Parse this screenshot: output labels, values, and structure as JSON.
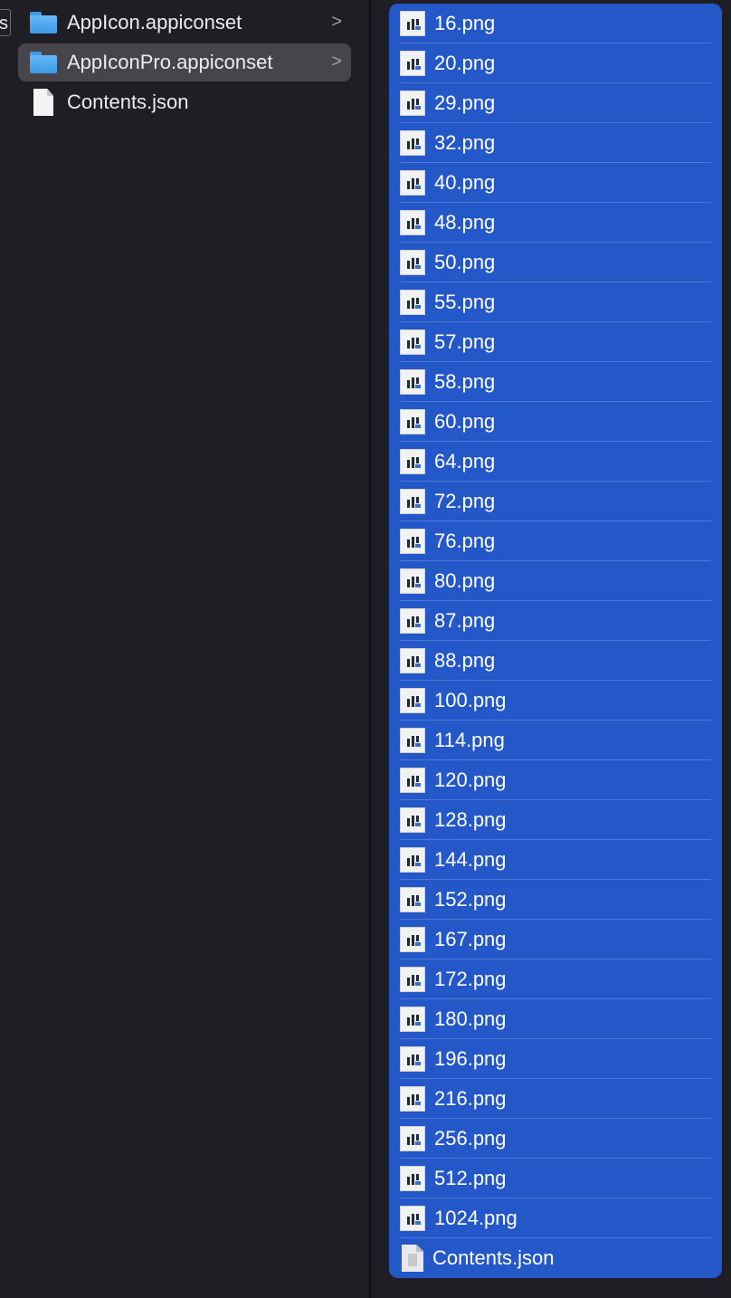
{
  "left_column": {
    "prev_column_edge": "s",
    "items": [
      {
        "label": "AppIcon.appiconset",
        "icon": "folder-icon",
        "has_chevron": true,
        "selected": false
      },
      {
        "label": "AppIconPro.appiconset",
        "icon": "folder-icon",
        "has_chevron": true,
        "selected": true
      },
      {
        "label": "Contents.json",
        "icon": "document-icon",
        "has_chevron": false,
        "selected": false
      }
    ],
    "chevron": ">"
  },
  "right_column": {
    "files": [
      {
        "label": "16.png",
        "icon": "png-image-icon"
      },
      {
        "label": "20.png",
        "icon": "png-image-icon"
      },
      {
        "label": "29.png",
        "icon": "png-image-icon"
      },
      {
        "label": "32.png",
        "icon": "png-image-icon"
      },
      {
        "label": "40.png",
        "icon": "png-image-icon"
      },
      {
        "label": "48.png",
        "icon": "png-image-icon"
      },
      {
        "label": "50.png",
        "icon": "png-image-icon"
      },
      {
        "label": "55.png",
        "icon": "png-image-icon"
      },
      {
        "label": "57.png",
        "icon": "png-image-icon"
      },
      {
        "label": "58.png",
        "icon": "png-image-icon"
      },
      {
        "label": "60.png",
        "icon": "png-image-icon"
      },
      {
        "label": "64.png",
        "icon": "png-image-icon"
      },
      {
        "label": "72.png",
        "icon": "png-image-icon"
      },
      {
        "label": "76.png",
        "icon": "png-image-icon"
      },
      {
        "label": "80.png",
        "icon": "png-image-icon"
      },
      {
        "label": "87.png",
        "icon": "png-image-icon"
      },
      {
        "label": "88.png",
        "icon": "png-image-icon"
      },
      {
        "label": "100.png",
        "icon": "png-image-icon"
      },
      {
        "label": "114.png",
        "icon": "png-image-icon"
      },
      {
        "label": "120.png",
        "icon": "png-image-icon"
      },
      {
        "label": "128.png",
        "icon": "png-image-icon"
      },
      {
        "label": "144.png",
        "icon": "png-image-icon"
      },
      {
        "label": "152.png",
        "icon": "png-image-icon"
      },
      {
        "label": "167.png",
        "icon": "png-image-icon"
      },
      {
        "label": "172.png",
        "icon": "png-image-icon"
      },
      {
        "label": "180.png",
        "icon": "png-image-icon"
      },
      {
        "label": "196.png",
        "icon": "png-image-icon"
      },
      {
        "label": "216.png",
        "icon": "png-image-icon"
      },
      {
        "label": "256.png",
        "icon": "png-image-icon"
      },
      {
        "label": "512.png",
        "icon": "png-image-icon"
      },
      {
        "label": "1024.png",
        "icon": "png-image-icon"
      },
      {
        "label": "Contents.json",
        "icon": "json-document-icon"
      }
    ]
  },
  "colors": {
    "window_background": "#1f1e25",
    "selection_highlight": "#2458c8",
    "selected_folder_row": "#46454c",
    "folder_blue": "#3d9ae6",
    "text_primary": "#ececf0"
  }
}
